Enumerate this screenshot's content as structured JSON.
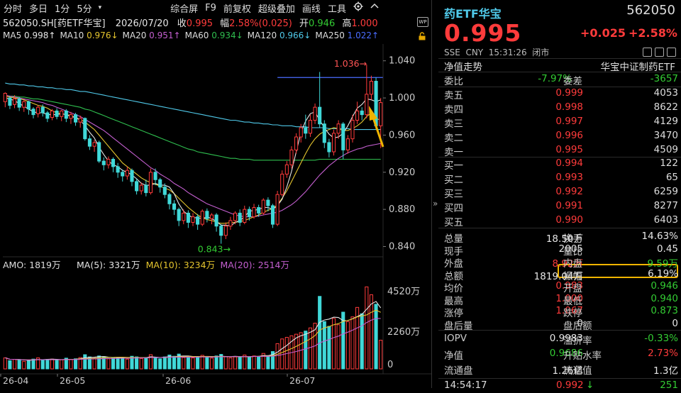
{
  "toolbar": {
    "period_tabs": [
      "分时",
      "多日",
      "1分",
      "5分"
    ],
    "more_symbol": "▾",
    "tools": [
      "综合屏",
      "F9",
      "前复权",
      "超级叠加",
      "画线",
      "工具"
    ],
    "settings_icon": "gear-icon",
    "collapse_icon": "chevron-up-icon"
  },
  "infoline": {
    "code_name": "562050.SH[药ETF华宝]",
    "date": "2026/07/20",
    "close_label": "收",
    "close_value": "0.995",
    "change_label": "幅",
    "change_value": "2.58%(0.025)",
    "open_label": "开",
    "open_value": "0.946",
    "high_label": "高",
    "high_value": "1.000"
  },
  "maline": [
    {
      "label": "MA5",
      "value": "0.998↑",
      "color": "#e6e6e6"
    },
    {
      "label": "MA10",
      "value": "0.976↓",
      "color": "#e5c52e"
    },
    {
      "label": "MA20",
      "value": "0.951↑",
      "color": "#c45fd0"
    },
    {
      "label": "MA60",
      "value": "0.934↓",
      "color": "#2fbf4f"
    },
    {
      "label": "MA120",
      "value": "0.966↓",
      "color": "#4fc8e8"
    },
    {
      "label": "MA250",
      "value": "1.022↑",
      "color": "#4a6cff"
    }
  ],
  "chart_data": {
    "type": "candlestick",
    "price_axis_ticks": [
      "1.040",
      "1.000",
      "0.960",
      "0.920",
      "0.880",
      "0.840"
    ],
    "price_range": [
      0.832,
      1.052
    ],
    "max_annotation": "1.036",
    "min_annotation": "0.843",
    "volume_label": "AMO: 1819万",
    "volume_ma": [
      {
        "label": "MA(5): 3321万",
        "color": "#e6e6e6"
      },
      {
        "label": "MA(10): 3234万",
        "color": "#e5c52e"
      },
      {
        "label": "MA(20): 2514万",
        "color": "#c45fd0"
      }
    ],
    "volume_axis_ticks": [
      "4520万",
      "2260万",
      "0"
    ],
    "x_axis_labels": [
      "26-04",
      "26-05",
      "26-06",
      "26-07"
    ],
    "candles": [
      [
        0.996,
        1.005,
        0.99,
        1.006
      ],
      [
        1.0,
        0.992,
        0.988,
        1.002
      ],
      [
        0.993,
        0.999,
        0.989,
        1.003
      ],
      [
        0.999,
        0.99,
        0.986,
        1.001
      ],
      [
        0.99,
        0.996,
        0.985,
        0.998
      ],
      [
        0.996,
        0.988,
        0.982,
        0.997
      ],
      [
        0.988,
        0.982,
        0.978,
        0.99
      ],
      [
        0.983,
        0.99,
        0.979,
        0.992
      ],
      [
        0.99,
        0.984,
        0.98,
        0.993
      ],
      [
        0.984,
        0.978,
        0.974,
        0.986
      ],
      [
        0.979,
        0.986,
        0.976,
        0.988
      ],
      [
        0.986,
        0.98,
        0.977,
        0.989
      ],
      [
        0.98,
        0.986,
        0.975,
        0.987
      ],
      [
        0.986,
        0.978,
        0.974,
        0.988
      ],
      [
        0.978,
        0.982,
        0.972,
        0.985
      ],
      [
        0.982,
        0.974,
        0.97,
        0.984
      ],
      [
        0.974,
        0.978,
        0.968,
        0.981
      ],
      [
        0.978,
        0.956,
        0.954,
        0.979
      ],
      [
        0.956,
        0.948,
        0.944,
        0.96
      ],
      [
        0.948,
        0.952,
        0.942,
        0.955
      ],
      [
        0.952,
        0.932,
        0.93,
        0.954
      ],
      [
        0.932,
        0.928,
        0.922,
        0.936
      ],
      [
        0.928,
        0.934,
        0.924,
        0.937
      ],
      [
        0.934,
        0.926,
        0.92,
        0.936
      ],
      [
        0.926,
        0.92,
        0.914,
        0.93
      ],
      [
        0.92,
        0.916,
        0.91,
        0.923
      ],
      [
        0.916,
        0.922,
        0.912,
        0.926
      ],
      [
        0.922,
        0.91,
        0.905,
        0.924
      ],
      [
        0.91,
        0.9,
        0.896,
        0.913
      ],
      [
        0.9,
        0.906,
        0.896,
        0.909
      ],
      [
        0.906,
        0.898,
        0.894,
        0.912
      ],
      [
        0.898,
        0.92,
        0.896,
        0.924
      ],
      [
        0.92,
        0.912,
        0.906,
        0.924
      ],
      [
        0.912,
        0.904,
        0.898,
        0.914
      ],
      [
        0.904,
        0.896,
        0.892,
        0.908
      ],
      [
        0.896,
        0.886,
        0.88,
        0.898
      ],
      [
        0.886,
        0.88,
        0.874,
        0.89
      ],
      [
        0.88,
        0.868,
        0.862,
        0.882
      ],
      [
        0.868,
        0.876,
        0.864,
        0.88
      ],
      [
        0.876,
        0.866,
        0.86,
        0.879
      ],
      [
        0.866,
        0.872,
        0.862,
        0.876
      ],
      [
        0.872,
        0.864,
        0.858,
        0.875
      ],
      [
        0.864,
        0.878,
        0.862,
        0.88
      ],
      [
        0.878,
        0.87,
        0.866,
        0.881
      ],
      [
        0.87,
        0.874,
        0.864,
        0.876
      ],
      [
        0.874,
        0.862,
        0.856,
        0.876
      ],
      [
        0.862,
        0.852,
        0.843,
        0.864
      ],
      [
        0.852,
        0.862,
        0.848,
        0.866
      ],
      [
        0.862,
        0.868,
        0.858,
        0.872
      ],
      [
        0.868,
        0.876,
        0.864,
        0.878
      ],
      [
        0.876,
        0.866,
        0.862,
        0.88
      ],
      [
        0.866,
        0.88,
        0.864,
        0.884
      ],
      [
        0.88,
        0.872,
        0.868,
        0.883
      ],
      [
        0.872,
        0.882,
        0.87,
        0.886
      ],
      [
        0.882,
        0.876,
        0.872,
        0.885
      ],
      [
        0.876,
        0.89,
        0.874,
        0.892
      ],
      [
        0.89,
        0.884,
        0.878,
        0.893
      ],
      [
        0.884,
        0.864,
        0.86,
        0.886
      ],
      [
        0.864,
        0.896,
        0.862,
        0.9
      ],
      [
        0.896,
        0.918,
        0.894,
        0.922
      ],
      [
        0.918,
        0.928,
        0.914,
        0.932
      ],
      [
        0.928,
        0.944,
        0.924,
        0.948
      ],
      [
        0.944,
        0.958,
        0.94,
        0.962
      ],
      [
        0.958,
        0.968,
        0.952,
        0.972
      ],
      [
        0.968,
        0.962,
        0.956,
        0.982
      ],
      [
        0.962,
        0.976,
        0.958,
        0.982
      ],
      [
        0.976,
        0.99,
        0.972,
        0.994
      ],
      [
        0.99,
        0.972,
        0.968,
        1.028
      ],
      [
        0.972,
        0.952,
        0.946,
        0.976
      ],
      [
        0.952,
        0.942,
        0.936,
        0.956
      ],
      [
        0.942,
        0.962,
        0.938,
        0.966
      ],
      [
        0.962,
        0.972,
        0.956,
        0.976
      ],
      [
        0.972,
        0.944,
        0.934,
        0.974
      ],
      [
        0.944,
        0.956,
        0.94,
        0.96
      ],
      [
        0.956,
        0.976,
        0.952,
        0.982
      ],
      [
        0.976,
        0.986,
        0.972,
        0.996
      ],
      [
        0.986,
        0.982,
        0.976,
        0.99
      ],
      [
        0.982,
        1.004,
        0.978,
        1.036
      ],
      [
        1.004,
        1.018,
        0.998,
        1.024
      ],
      [
        1.018,
        0.97,
        0.966,
        1.022
      ],
      [
        0.97,
        0.995,
        0.946,
        1.0
      ]
    ],
    "volumes": [
      700,
      520,
      600,
      560,
      480,
      560,
      620,
      700,
      540,
      600,
      620,
      560,
      580,
      680,
      600,
      640,
      720,
      900,
      760,
      680,
      820,
      780,
      640,
      700,
      720,
      680,
      620,
      800,
      760,
      660,
      720,
      900,
      700,
      640,
      760,
      880,
      800,
      940,
      720,
      760,
      700,
      780,
      860,
      720,
      680,
      820,
      920,
      780,
      700,
      760,
      740,
      880,
      760,
      820,
      780,
      980,
      840,
      1100,
      1600,
      1900,
      2000,
      2100,
      2200,
      2300,
      2400,
      2600,
      2900,
      4600,
      3000,
      2700,
      3200,
      2800,
      3600,
      3000,
      3300,
      3900,
      3500,
      5200,
      4700,
      4100,
      1819
    ],
    "ma_lines": [
      {
        "name": "MA5",
        "color": "#e6e6e6",
        "values": [
          1.0,
          0.999,
          0.997,
          0.994,
          0.991,
          0.988,
          0.985,
          0.984,
          0.984,
          0.982,
          0.982,
          0.982,
          0.983,
          0.982,
          0.98,
          0.979,
          0.976,
          0.97,
          0.963,
          0.957,
          0.947,
          0.939,
          0.932,
          0.928,
          0.926,
          0.922,
          0.92,
          0.917,
          0.913,
          0.908,
          0.906,
          0.906,
          0.908,
          0.906,
          0.906,
          0.904,
          0.897,
          0.886,
          0.878,
          0.874,
          0.871,
          0.871,
          0.87,
          0.872,
          0.87,
          0.867,
          0.863,
          0.863,
          0.862,
          0.866,
          0.868,
          0.872,
          0.878,
          0.879,
          0.88,
          0.882,
          0.882,
          0.88,
          0.884,
          0.891,
          0.904,
          0.921,
          0.942,
          0.963,
          0.975,
          0.983,
          0.985,
          0.976,
          0.968,
          0.961,
          0.957,
          0.958,
          0.962,
          0.97,
          0.98,
          0.989,
          0.993,
          0.999,
          0.998,
          0.996,
          0.998
        ]
      },
      {
        "name": "MA10",
        "color": "#e5c52e",
        "values": [
          1.002,
          1.001,
          1.0,
          0.999,
          0.998,
          0.996,
          0.994,
          0.992,
          0.991,
          0.989,
          0.986,
          0.984,
          0.983,
          0.982,
          0.981,
          0.979,
          0.977,
          0.974,
          0.97,
          0.966,
          0.96,
          0.954,
          0.948,
          0.942,
          0.936,
          0.93,
          0.926,
          0.922,
          0.918,
          0.914,
          0.911,
          0.909,
          0.907,
          0.905,
          0.903,
          0.901,
          0.897,
          0.892,
          0.887,
          0.882,
          0.878,
          0.874,
          0.871,
          0.869,
          0.868,
          0.866,
          0.865,
          0.865,
          0.866,
          0.866,
          0.867,
          0.868,
          0.87,
          0.872,
          0.874,
          0.877,
          0.879,
          0.881,
          0.885,
          0.892,
          0.9,
          0.91,
          0.92,
          0.93,
          0.94,
          0.949,
          0.956,
          0.961,
          0.964,
          0.966,
          0.968,
          0.967,
          0.965,
          0.965,
          0.967,
          0.97,
          0.974,
          0.98,
          0.984,
          0.978,
          0.976
        ]
      },
      {
        "name": "MA20",
        "color": "#c45fd0",
        "values": [
          1.003,
          1.002,
          1.001,
          1.0,
          0.999,
          0.998,
          0.997,
          0.996,
          0.995,
          0.993,
          0.992,
          0.99,
          0.988,
          0.986,
          0.984,
          0.982,
          0.98,
          0.977,
          0.974,
          0.971,
          0.968,
          0.965,
          0.961,
          0.957,
          0.953,
          0.949,
          0.945,
          0.941,
          0.937,
          0.933,
          0.929,
          0.925,
          0.922,
          0.918,
          0.915,
          0.912,
          0.908,
          0.905,
          0.902,
          0.898,
          0.895,
          0.892,
          0.889,
          0.886,
          0.884,
          0.882,
          0.88,
          0.878,
          0.876,
          0.874,
          0.873,
          0.872,
          0.872,
          0.872,
          0.873,
          0.874,
          0.875,
          0.876,
          0.877,
          0.879,
          0.882,
          0.885,
          0.889,
          0.894,
          0.899,
          0.905,
          0.911,
          0.917,
          0.922,
          0.927,
          0.931,
          0.935,
          0.938,
          0.941,
          0.943,
          0.945,
          0.946,
          0.948,
          0.949,
          0.95,
          0.951
        ]
      },
      {
        "name": "MA60",
        "color": "#2fbf4f",
        "values": [
          1.003,
          1.002,
          1.002,
          1.001,
          1.001,
          1.0,
          0.999,
          0.999,
          0.998,
          0.997,
          0.996,
          0.995,
          0.994,
          0.993,
          0.992,
          0.991,
          0.99,
          0.988,
          0.987,
          0.985,
          0.983,
          0.981,
          0.979,
          0.977,
          0.975,
          0.973,
          0.971,
          0.969,
          0.967,
          0.965,
          0.963,
          0.961,
          0.959,
          0.957,
          0.955,
          0.953,
          0.951,
          0.949,
          0.947,
          0.945,
          0.944,
          0.942,
          0.941,
          0.94,
          0.939,
          0.938,
          0.937,
          0.936,
          0.935,
          0.935,
          0.934,
          0.934,
          0.934,
          0.933,
          0.933,
          0.933,
          0.933,
          0.933,
          0.933,
          0.933,
          0.933,
          0.933,
          0.933,
          0.933,
          0.933,
          0.933,
          0.933,
          0.934,
          0.934,
          0.934,
          0.934,
          0.934,
          0.934,
          0.934,
          0.934,
          0.934,
          0.934,
          0.934,
          0.934,
          0.934,
          0.934
        ]
      },
      {
        "name": "MA120",
        "color": "#4fc8e8",
        "values": [
          1.016,
          1.015,
          1.015,
          1.014,
          1.014,
          1.013,
          1.013,
          1.012,
          1.012,
          1.011,
          1.011,
          1.01,
          1.01,
          1.009,
          1.009,
          1.008,
          1.007,
          1.007,
          1.006,
          1.005,
          1.004,
          1.003,
          1.002,
          1.001,
          1.0,
          0.999,
          0.998,
          0.997,
          0.996,
          0.995,
          0.994,
          0.993,
          0.992,
          0.991,
          0.99,
          0.989,
          0.988,
          0.987,
          0.986,
          0.985,
          0.984,
          0.983,
          0.982,
          0.981,
          0.98,
          0.979,
          0.978,
          0.977,
          0.976,
          0.976,
          0.975,
          0.974,
          0.974,
          0.973,
          0.973,
          0.972,
          0.972,
          0.971,
          0.971,
          0.97,
          0.97,
          0.97,
          0.969,
          0.969,
          0.969,
          0.968,
          0.968,
          0.968,
          0.968,
          0.967,
          0.967,
          0.967,
          0.967,
          0.967,
          0.966,
          0.966,
          0.966,
          0.966,
          0.966,
          0.966,
          0.966
        ]
      }
    ],
    "ma250_level": 1.022,
    "ma250_start_index": 58
  },
  "right": {
    "name": "药ETF华宝",
    "code": "562050",
    "price": "0.995",
    "change": "+0.025",
    "change_pct": "+2.58%",
    "sub_info": "SSE  CNY  15:31:26  闭市",
    "tab_left": "净值走势",
    "tab_right": "华宝中证制药ETF",
    "commission": {
      "label1": "委比",
      "value1": "-7.97%",
      "label2": "委差",
      "value2": "-3657"
    },
    "asks": [
      {
        "label": "卖五",
        "price": "0.999",
        "vol": "4053"
      },
      {
        "label": "卖四",
        "price": "0.998",
        "vol": "8622"
      },
      {
        "label": "卖三",
        "price": "0.997",
        "vol": "4129"
      },
      {
        "label": "卖二",
        "price": "0.996",
        "vol": "3470"
      },
      {
        "label": "卖一",
        "price": "0.995",
        "vol": "4509"
      }
    ],
    "bids": [
      {
        "label": "买一",
        "price": "0.994",
        "vol": "122"
      },
      {
        "label": "买二",
        "price": "0.993",
        "vol": "65"
      },
      {
        "label": "买三",
        "price": "0.992",
        "vol": "6259"
      },
      {
        "label": "买四",
        "price": "0.991",
        "vol": "8277"
      },
      {
        "label": "买五",
        "price": "0.990",
        "vol": "6403"
      }
    ],
    "stats": [
      {
        "l1": "总量",
        "v1": "18.50万",
        "c1": "#e6e6e6",
        "l2": "换手",
        "v2": "14.63%",
        "c2": "#e6e6e6"
      },
      {
        "l1": "现手",
        "v1": "2005",
        "c1": "#e6e6e6",
        "l2": "量比",
        "v2": "0.45",
        "c2": "#e6e6e6"
      },
      {
        "l1": "外盘",
        "v1": "8.92万",
        "c1": "#ff3b3b",
        "l2": "内盘",
        "v2": "9.59万",
        "c2": "#33cc33"
      },
      {
        "l1": "总额",
        "v1": "1819.04万",
        "c1": "#e6e6e6",
        "l2": "振幅",
        "v2": "6.19%",
        "c2": "#e6e6e6"
      },
      {
        "l1": "均价",
        "v1": "0.983",
        "c1": "#ff3b3b",
        "l2": "开盘",
        "v2": "0.946",
        "c2": "#33cc33"
      },
      {
        "l1": "最高",
        "v1": "1.000",
        "c1": "#ff3b3b",
        "l2": "最低",
        "v2": "0.940",
        "c2": "#33cc33"
      },
      {
        "l1": "涨停",
        "v1": "1.067",
        "c1": "#ff3b3b",
        "l2": "跌停",
        "v2": "0.873",
        "c2": "#33cc33"
      },
      {
        "l1": "盘后量",
        "v1": "0",
        "c1": "#e6e6e6",
        "l2": "盘后额",
        "v2": "0",
        "c2": "#e6e6e6"
      }
    ],
    "extra": [
      {
        "l1": "IOPV",
        "v1": "0.9983",
        "c1": "#e6e6e6",
        "l2": "溢折率",
        "v2": "-0.33%",
        "c2": "#33cc33"
      },
      {
        "l1": "净值",
        "v1": "0.9686",
        "c1": "#33cc33",
        "l2": "升贴水率",
        "v2": "2.73%",
        "c2": "#ff3b3b"
      },
      {
        "l1": "流通盘",
        "v1": "1.26亿",
        "c1": "#e6e6e6",
        "l2": "流通值",
        "v2": "1.3亿",
        "c2": "#e6e6e6"
      }
    ],
    "tick": {
      "time": "14:54:17",
      "price": "0.992",
      "arrow": "↓",
      "vol": "251"
    }
  },
  "colors": {
    "up": "#ff3b3b",
    "down": "#33cc33",
    "candle_up": "#ff3b3b",
    "candle_down": "#40d8d8",
    "highlight": "#f0b400",
    "arrow": "#f0b400"
  }
}
